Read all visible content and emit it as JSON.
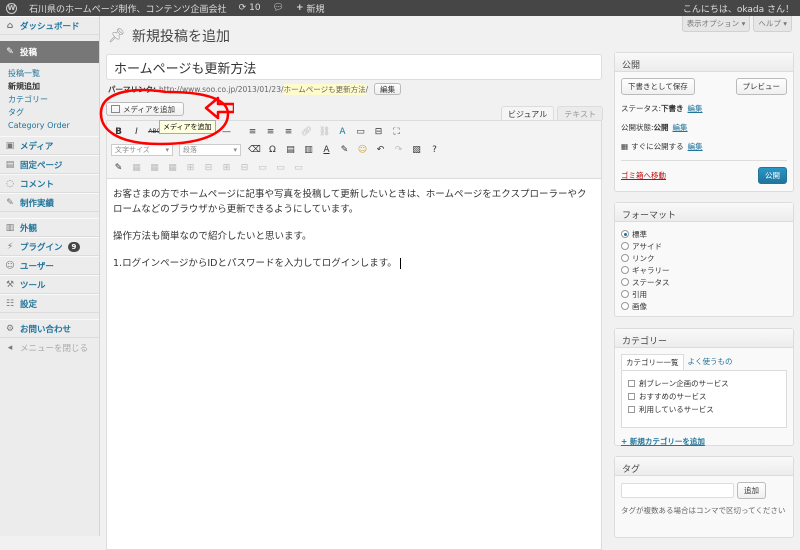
{
  "adminbar": {
    "site_name": "石川県のホームページ制作、コンテンツ企画会社",
    "updates_count": "10",
    "new_label": "新規",
    "greeting": "こんにちは、okada さん！"
  },
  "sidebar": {
    "dashboard": "ダッシュボード",
    "posts": "投稿",
    "submenu": [
      "投稿一覧",
      "新規追加",
      "カテゴリー",
      "タグ",
      "Category Order"
    ],
    "media": "メディア",
    "pages": "固定ページ",
    "comments": "コメント",
    "works": "制作実績",
    "appearance": "外観",
    "plugins": "プラグイン",
    "plugins_badge": "9",
    "users": "ユーザー",
    "tools": "ツール",
    "settings": "設定",
    "contact": "お問い合わせ",
    "collapse": "メニューを閉じる"
  },
  "header": {
    "screen_options": "表示オプション ▾",
    "help": "ヘルプ ▾",
    "page_title": "新規投稿を追加"
  },
  "editor": {
    "title_value": "ホームページも更新方法",
    "permalink_label": "パーマリンク:",
    "permalink_base": "http://www.soo.co.jp/2013/01/23/",
    "permalink_slug": "ホームページも更新方法",
    "permalink_trailing": "/",
    "edit_button": "編集",
    "add_media": "メディアを追加",
    "tooltip": "メディアを追加",
    "tab_visual": "ビジュアル",
    "tab_text": "テキスト",
    "font_size_select": "文字サイズ",
    "format_select": "段落",
    "paragraphs": [
      "お客さまの方でホームページに記事や写真を投稿して更新したいときは、ホームページをエクスプローラーやクロームなどのブラウザから更新できるようにしています。",
      "操作方法も簡単なので紹介したいと思います。",
      "1.ログインページからIDとパスワードを入力してログインします。"
    ]
  },
  "publish": {
    "title": "公開",
    "save_draft": "下書きとして保存",
    "preview": "プレビュー",
    "status_label": "ステータス:",
    "status_value": "下書き",
    "visibility_label": "公開状態:",
    "visibility_value": "公開",
    "schedule_label": "すぐに公開する",
    "edit": "編集",
    "trash": "ゴミ箱へ移動",
    "publish_button": "公開"
  },
  "format": {
    "title": "フォーマット",
    "options": [
      "標準",
      "アサイド",
      "リンク",
      "ギャラリー",
      "ステータス",
      "引用",
      "画像"
    ],
    "selected": 0
  },
  "category": {
    "title": "カテゴリー",
    "tab_all": "カテゴリー一覧",
    "tab_popular": "よく使うもの",
    "items": [
      "創ブレーン企画のサービス",
      "おすすめのサービス",
      "利用しているサービス"
    ],
    "add_new": "+ 新規カテゴリーを追加"
  },
  "tags": {
    "title": "タグ",
    "add_button": "追加",
    "note": "タグが複数ある場合はコンマで区切ってください"
  },
  "colors": {
    "accent": "#21759b",
    "annotation": "#ff0000"
  }
}
